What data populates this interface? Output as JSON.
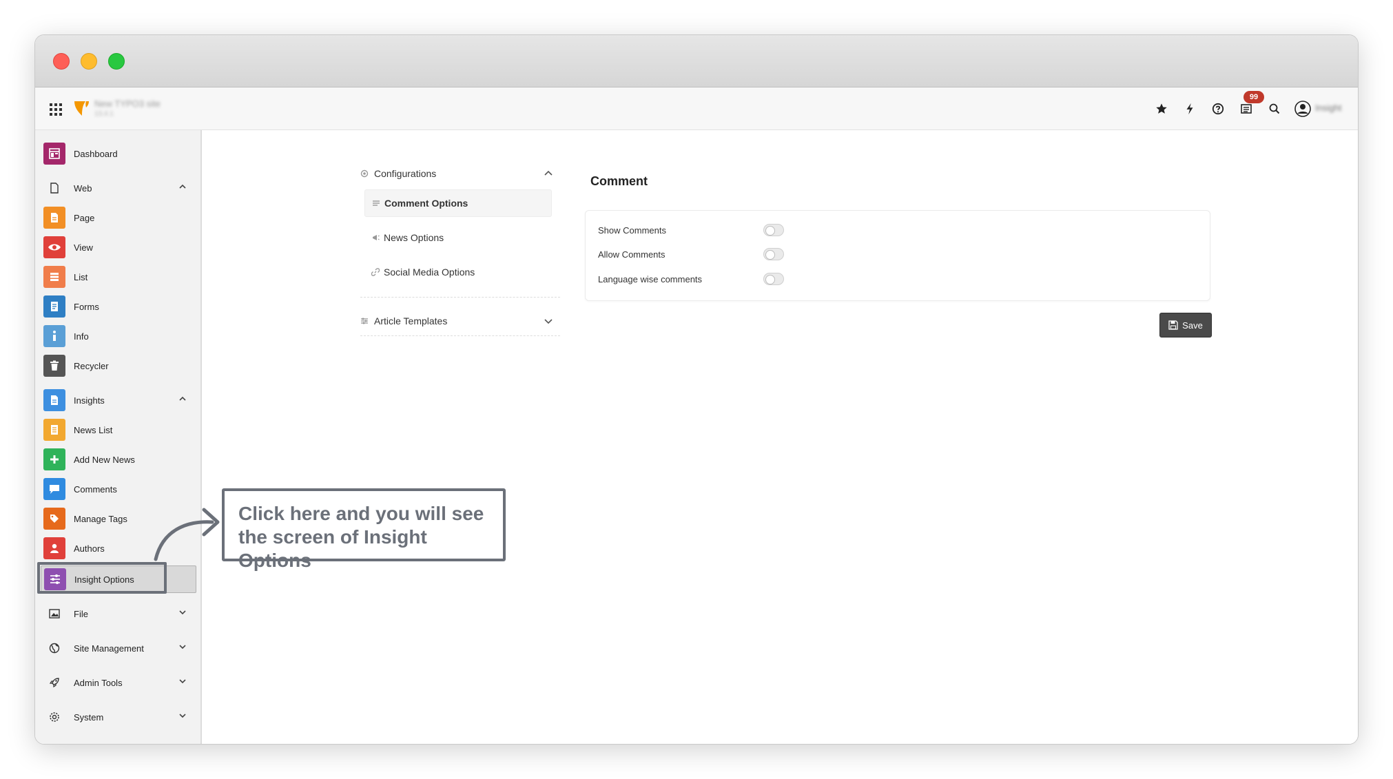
{
  "colors": {
    "accent_orange": "#f49700",
    "badge_red": "#c0392b",
    "annotation_gray": "#6b7079",
    "save_bg": "#4a4a4a"
  },
  "topbar": {
    "site_name": "New TYPO3 site",
    "site_version": "13.4.1",
    "notification_count": "99",
    "user_name": "Insight",
    "icons": [
      "module-menu-icon",
      "typo3-logo",
      "bookmark-star-icon",
      "flash-clear-cache-icon",
      "help-icon",
      "system-information-icon",
      "search-icon",
      "user-avatar-icon"
    ]
  },
  "sidebar": {
    "dashboard": "Dashboard",
    "web": "Web",
    "web_items": [
      "Page",
      "View",
      "List",
      "Forms",
      "Info",
      "Recycler"
    ],
    "insights": "Insights",
    "insights_items": [
      "News List",
      "Add New News",
      "Comments",
      "Manage Tags",
      "Authors",
      "Insight Options"
    ],
    "file": "File",
    "site_management": "Site Management",
    "admin_tools": "Admin Tools",
    "system": "System"
  },
  "config_panel": {
    "configurations": "Configurations",
    "comment_options": "Comment Options",
    "news_options": "News Options",
    "social_media_options": "Social Media Options",
    "article_templates": "Article Templates"
  },
  "comment_section": {
    "title": "Comment",
    "options": [
      {
        "label": "Show Comments",
        "enabled": false
      },
      {
        "label": "Allow Comments",
        "enabled": false
      },
      {
        "label": "Language wise comments",
        "enabled": false
      }
    ],
    "save_label": "Save"
  },
  "annotation": {
    "line1": "Click here and you will see",
    "line2": "the screen of Insight Options"
  }
}
